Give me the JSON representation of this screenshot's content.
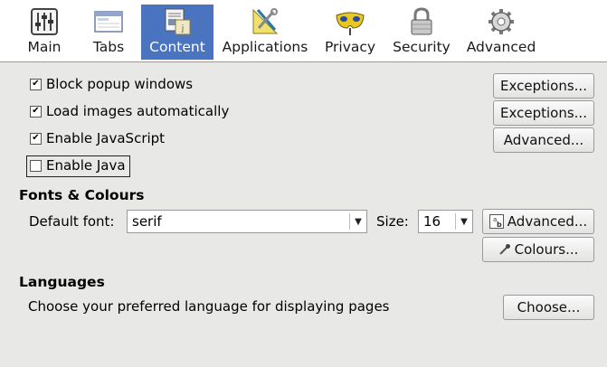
{
  "toolbar": {
    "tabs": [
      {
        "label": "Main",
        "icon": "sliders-icon"
      },
      {
        "label": "Tabs",
        "icon": "tabs-window-icon"
      },
      {
        "label": "Content",
        "icon": "content-page-icon"
      },
      {
        "label": "Applications",
        "icon": "applications-tools-icon"
      },
      {
        "label": "Privacy",
        "icon": "privacy-mask-icon"
      },
      {
        "label": "Security",
        "icon": "padlock-icon"
      },
      {
        "label": "Advanced",
        "icon": "gear-icon"
      }
    ],
    "selected": "Content"
  },
  "content": {
    "block_popups": {
      "label": "Block popup windows",
      "checked": true,
      "button": "Exceptions..."
    },
    "load_images": {
      "label": "Load images automatically",
      "checked": true,
      "button": "Exceptions..."
    },
    "enable_js": {
      "label": "Enable JavaScript",
      "checked": true,
      "button": "Advanced..."
    },
    "enable_java": {
      "label": "Enable Java",
      "checked": false
    }
  },
  "fonts": {
    "heading": "Fonts & Colours",
    "default_font_label": "Default font:",
    "default_font_value": "serif",
    "size_label": "Size:",
    "size_value": "16",
    "advanced_button": "Advanced...",
    "colours_button": "Colours..."
  },
  "languages": {
    "heading": "Languages",
    "description": "Choose your preferred language for displaying pages",
    "choose_button": "Choose..."
  },
  "colors": {
    "selected_tab": "#4a73c0",
    "background": "#e8e8e7"
  }
}
